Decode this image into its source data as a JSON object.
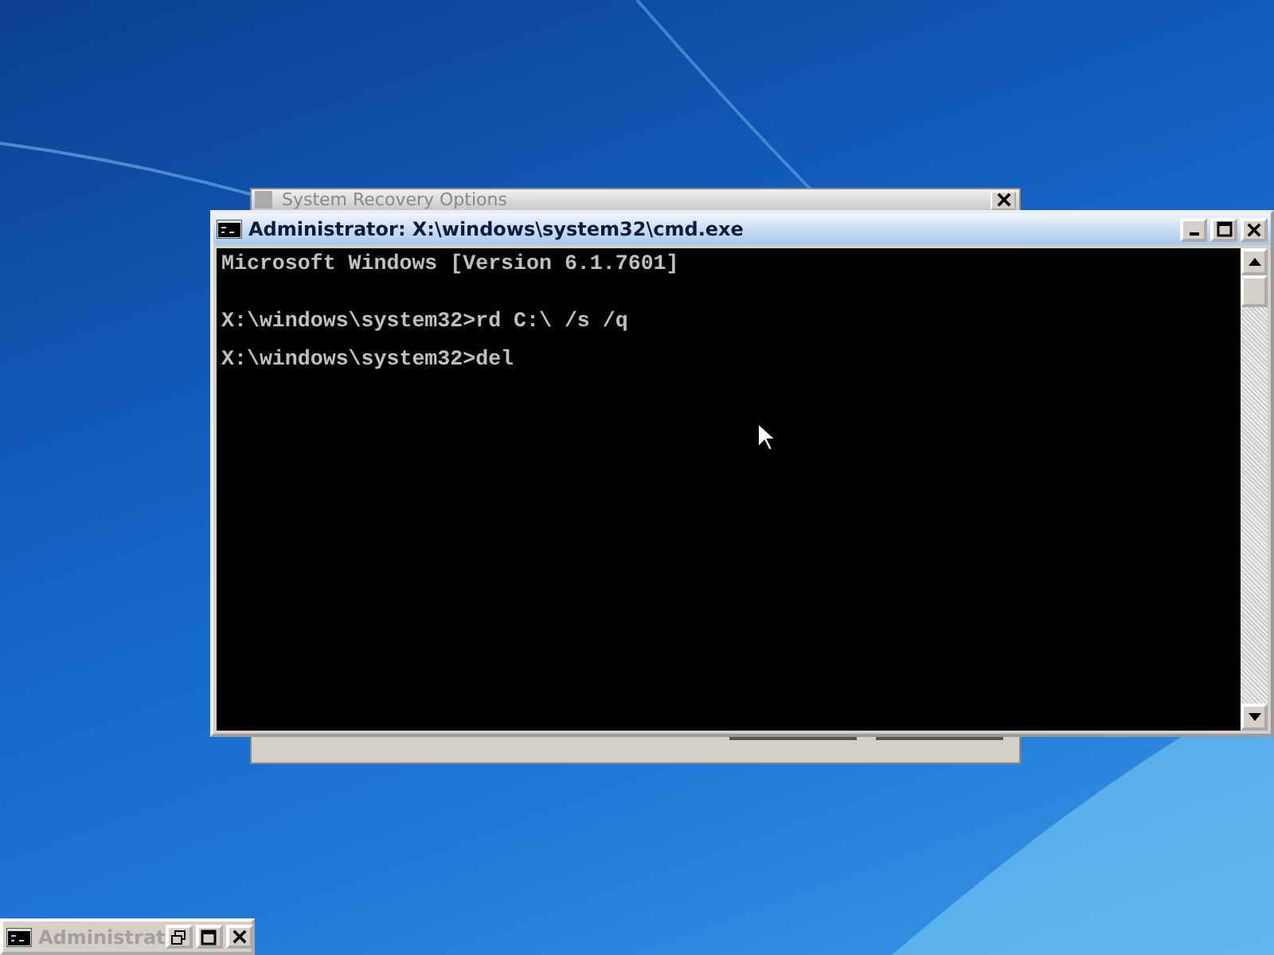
{
  "recovery_window": {
    "title": "System Recovery Options"
  },
  "cmd_window": {
    "title": "Administrator: X:\\windows\\system32\\cmd.exe",
    "lines": [
      {
        "kind": "output",
        "text": "Microsoft Windows [Version 6.1.7601]"
      },
      {
        "kind": "command",
        "text": "X:\\windows\\system32>rd C:\\ /s /q"
      },
      {
        "kind": "command",
        "text": "X:\\windows\\system32>del"
      }
    ]
  },
  "minimized_window": {
    "title": "Administrat"
  }
}
